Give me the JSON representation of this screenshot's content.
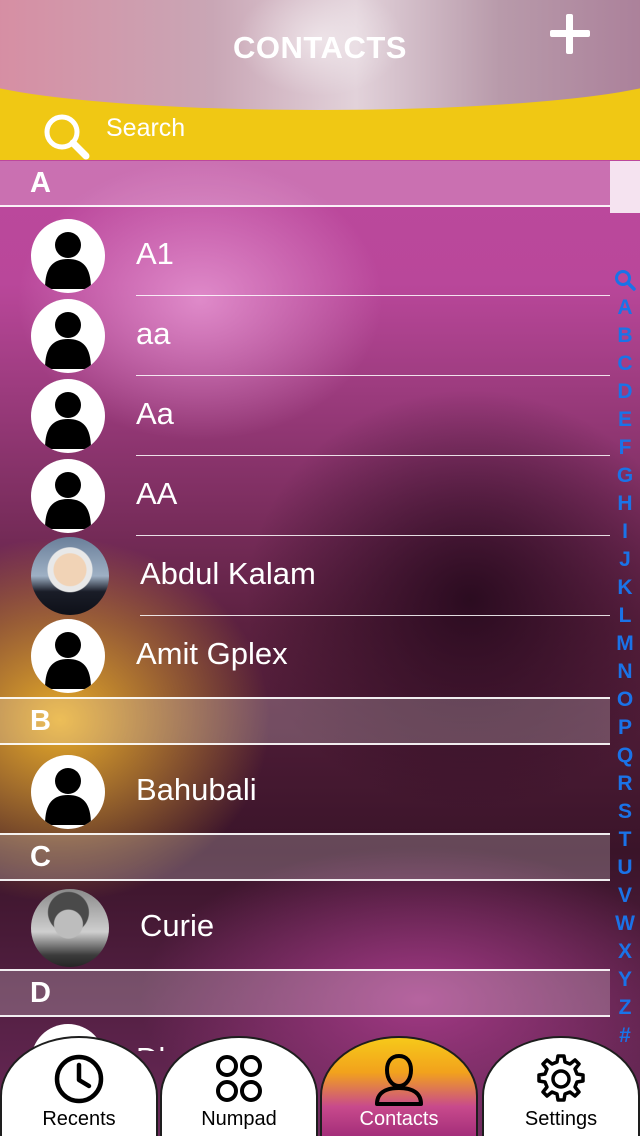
{
  "header": {
    "title": "CONTACTS",
    "add_icon": "plus-icon"
  },
  "search": {
    "placeholder": "Search",
    "icon": "search-icon"
  },
  "sections": [
    {
      "letter": "A",
      "contacts": [
        {
          "name": "A1",
          "avatar": "default"
        },
        {
          "name": "aa",
          "avatar": "default"
        },
        {
          "name": "Aa",
          "avatar": "default"
        },
        {
          "name": "AA",
          "avatar": "default"
        },
        {
          "name": "Abdul Kalam",
          "avatar": "photo"
        },
        {
          "name": "Amit Gplex",
          "avatar": "default"
        }
      ]
    },
    {
      "letter": "B",
      "contacts": [
        {
          "name": "Bahubali",
          "avatar": "default"
        }
      ]
    },
    {
      "letter": "C",
      "contacts": [
        {
          "name": "Curie",
          "avatar": "photo"
        }
      ]
    },
    {
      "letter": "D",
      "contacts": [
        {
          "name": "Dh",
          "avatar": "default"
        }
      ]
    }
  ],
  "index_letters": [
    "Q",
    "A",
    "B",
    "C",
    "D",
    "E",
    "F",
    "G",
    "H",
    "I",
    "J",
    "K",
    "L",
    "M",
    "N",
    "O",
    "P",
    "Q",
    "R",
    "S",
    "T",
    "U",
    "V",
    "W",
    "X",
    "Y",
    "Z",
    "#"
  ],
  "tabs": [
    {
      "label": "Recents",
      "icon": "clock-icon"
    },
    {
      "label": "Numpad",
      "icon": "numpad-icon"
    },
    {
      "label": "Contacts",
      "icon": "person-icon",
      "active": true
    },
    {
      "label": "Settings",
      "icon": "gear-icon"
    }
  ],
  "colors": {
    "accent_yellow": "#f0c814",
    "index_blue": "#1a73e8",
    "active_tab_pink": "#c84a8c"
  }
}
